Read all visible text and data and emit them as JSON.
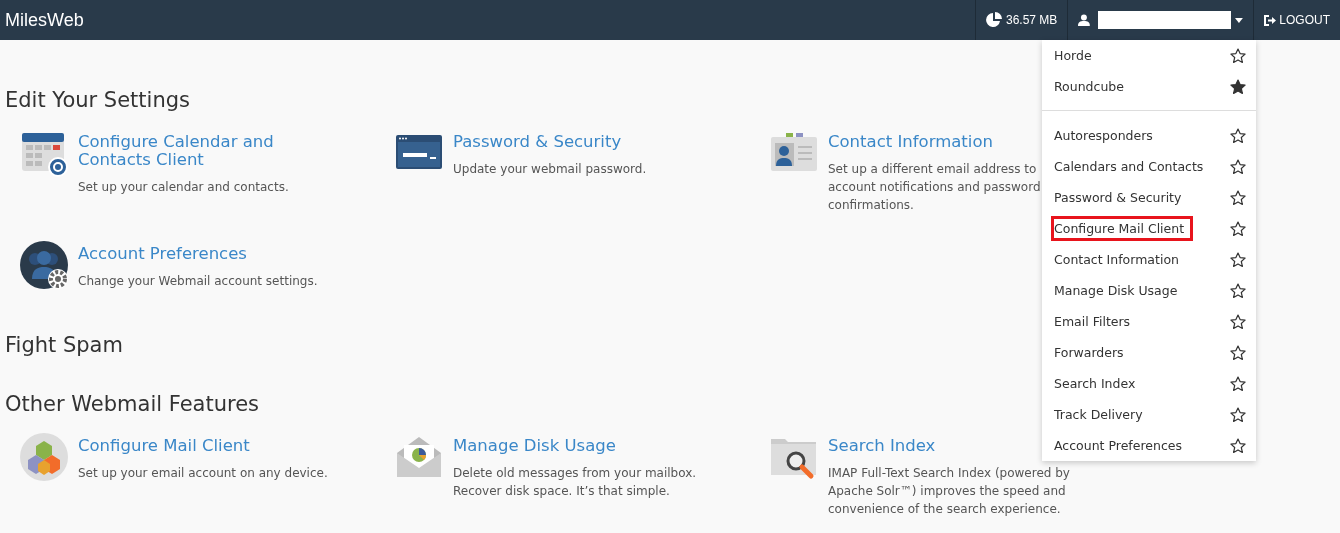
{
  "header": {
    "brand": "MilesWeb",
    "disk_usage": "36.57 MB",
    "logout": "LOGOUT"
  },
  "sections": [
    {
      "title": "Edit Your Settings",
      "items": [
        {
          "kind": "calendar",
          "title": "Configure Calendar and\nContacts Client",
          "description": "Set up your calendar and contacts."
        },
        {
          "kind": "password",
          "title": "Password & Security",
          "description": "Update your webmail password."
        },
        {
          "kind": "contact",
          "title": "Contact Information",
          "description": "Set up a different email address to\naccount notifications and password\nconfirmations."
        },
        {
          "kind": "preferences",
          "title": "Account Preferences",
          "description": "Change your Webmail account settings."
        }
      ]
    },
    {
      "title": "Fight Spam"
    },
    {
      "title": "Other Webmail Features",
      "items": [
        {
          "kind": "mailclient",
          "title": "Configure Mail Client",
          "description": "Set up your email account on any device."
        },
        {
          "kind": "disk",
          "title": "Manage Disk Usage",
          "description": "Delete old messages from your mailbox.\nRecover disk space. It’s that simple."
        },
        {
          "kind": "search",
          "title": "Search Index",
          "description": "IMAP Full-Text Search Index (powered by\nApache Solr™) improves the speed and\nconvenience of the search experience."
        }
      ]
    }
  ],
  "dropdown": {
    "groups": [
      [
        {
          "label": "Horde",
          "starred": false,
          "highlighted": false
        },
        {
          "label": "Roundcube",
          "starred": true,
          "highlighted": false
        }
      ],
      [
        {
          "label": "Autoresponders",
          "starred": false,
          "highlighted": false
        },
        {
          "label": "Calendars and Contacts",
          "starred": false,
          "highlighted": false
        },
        {
          "label": "Password & Security",
          "starred": false,
          "highlighted": false
        },
        {
          "label": "Configure Mail Client",
          "starred": false,
          "highlighted": true
        },
        {
          "label": "Contact Information",
          "starred": false,
          "highlighted": false
        },
        {
          "label": "Manage Disk Usage",
          "starred": false,
          "highlighted": false
        },
        {
          "label": "Email Filters",
          "starred": false,
          "highlighted": false
        },
        {
          "label": "Forwarders",
          "starred": false,
          "highlighted": false
        },
        {
          "label": "Search Index",
          "starred": false,
          "highlighted": false
        },
        {
          "label": "Track Delivery",
          "starred": false,
          "highlighted": false
        },
        {
          "label": "Account Preferences",
          "starred": false,
          "highlighted": false
        }
      ]
    ]
  }
}
